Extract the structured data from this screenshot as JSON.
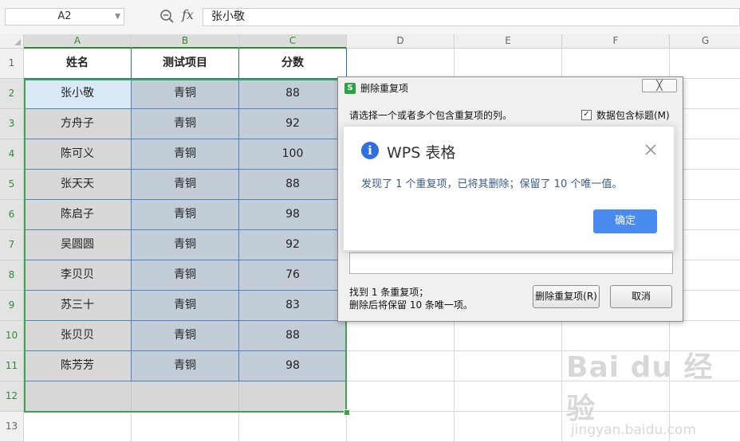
{
  "formula_bar": {
    "name_box": "A2",
    "fx_label": "fx",
    "formula_value": "张小敬"
  },
  "columns": [
    "A",
    "B",
    "C",
    "D",
    "E",
    "F",
    "G"
  ],
  "rows": [
    "1",
    "2",
    "3",
    "4",
    "5",
    "6",
    "7",
    "8",
    "9",
    "10",
    "11",
    "12",
    "13"
  ],
  "table": {
    "headers": [
      "姓名",
      "测试项目",
      "分数"
    ],
    "data": [
      [
        "张小敬",
        "青铜",
        "88"
      ],
      [
        "方舟子",
        "青铜",
        "92"
      ],
      [
        "陈可义",
        "青铜",
        "100"
      ],
      [
        "张天天",
        "青铜",
        "88"
      ],
      [
        "陈启子",
        "青铜",
        "98"
      ],
      [
        "吴圆圆",
        "青铜",
        "92"
      ],
      [
        "李贝贝",
        "青铜",
        "76"
      ],
      [
        "苏三十",
        "青铜",
        "83"
      ],
      [
        "张贝贝",
        "青铜",
        "88"
      ],
      [
        "陈芳芳",
        "青铜",
        "98"
      ]
    ]
  },
  "dialog": {
    "icon_letter": "S",
    "title": "删除重复项",
    "close_label": "╳",
    "instruction": "请选择一个或者多个包含重复项的列。",
    "checkbox_label": "数据包含标题(M)",
    "checkbox_checked": true,
    "status_line1": "找到 1 条重复项；",
    "status_line2": "删除后将保留 10 条唯一项。",
    "delete_button": "删除重复项(R)",
    "cancel_button": "取消"
  },
  "message_box": {
    "title": "WPS 表格",
    "message": "发现了 1 个重复项，已将其删除；保留了 10 个唯一值。",
    "ok_button": "确定"
  },
  "watermark": {
    "brand": "Bai du 经验",
    "url": "jingyan.baidu.com"
  },
  "colors": {
    "selection_green": "#3fa34d",
    "cell_border_blue": "#4a83c0",
    "ok_button_blue": "#4a8bef",
    "info_icon_blue": "#2f6fe0"
  }
}
